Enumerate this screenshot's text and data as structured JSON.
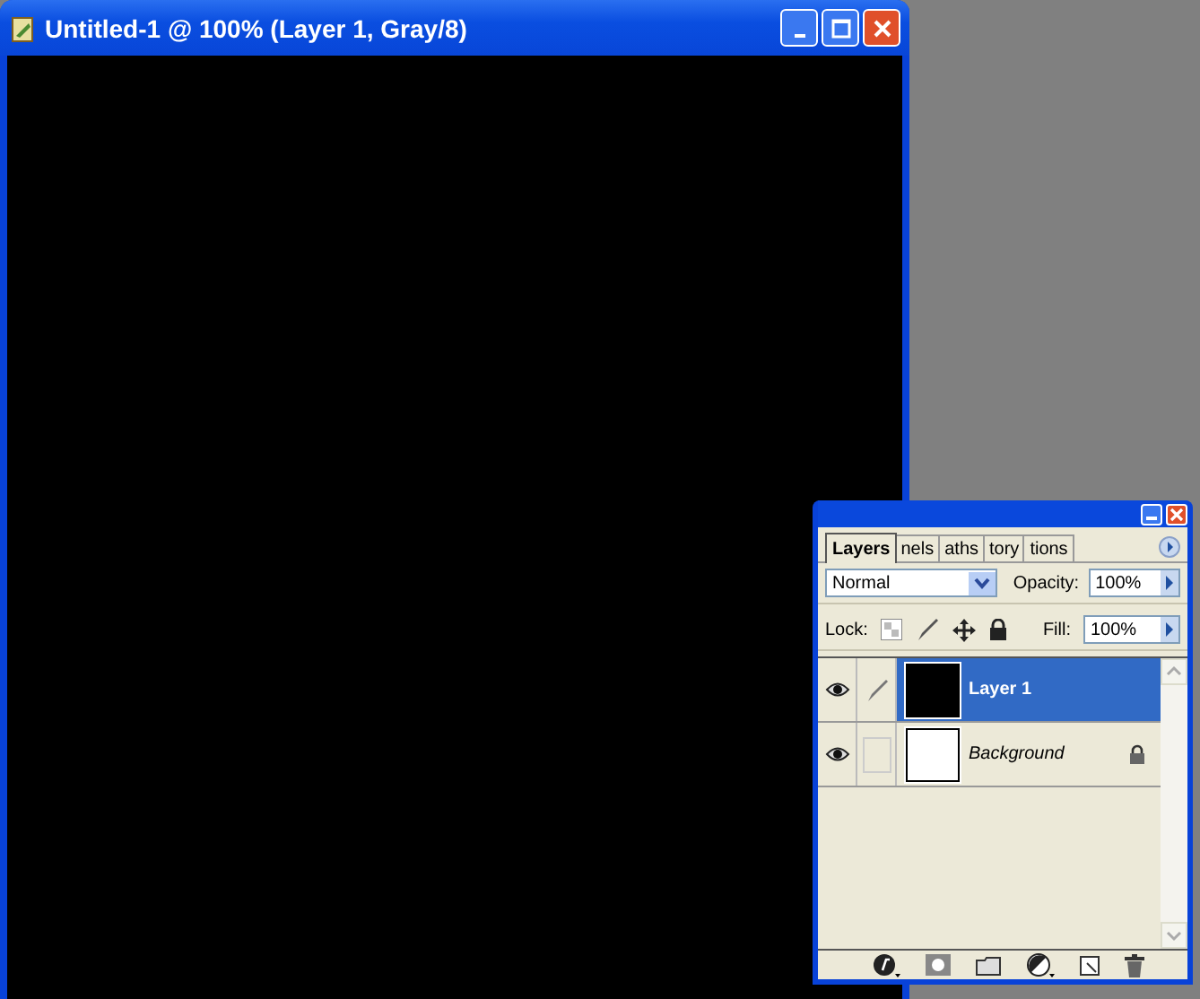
{
  "document_window": {
    "title": "Untitled-1 @ 100% (Layer 1, Gray/8)"
  },
  "layers_palette": {
    "tabs": [
      {
        "label": "Layers",
        "selected": true
      },
      {
        "label": "nels",
        "selected": false
      },
      {
        "label": "aths",
        "selected": false
      },
      {
        "label": "tory",
        "selected": false
      },
      {
        "label": "tions",
        "selected": false
      }
    ],
    "blend_mode": "Normal",
    "opacity_label": "Opacity:",
    "opacity": "100%",
    "lock_label": "Lock:",
    "fill_label": "Fill:",
    "fill": "100%",
    "layers": [
      {
        "name": "Layer 1",
        "selected": true,
        "visible": true,
        "linked_brush": true,
        "thumbnail_filled": true,
        "locked": false
      },
      {
        "name": "Background",
        "selected": false,
        "visible": true,
        "linked_brush": false,
        "thumbnail_filled": false,
        "locked": true
      }
    ]
  }
}
